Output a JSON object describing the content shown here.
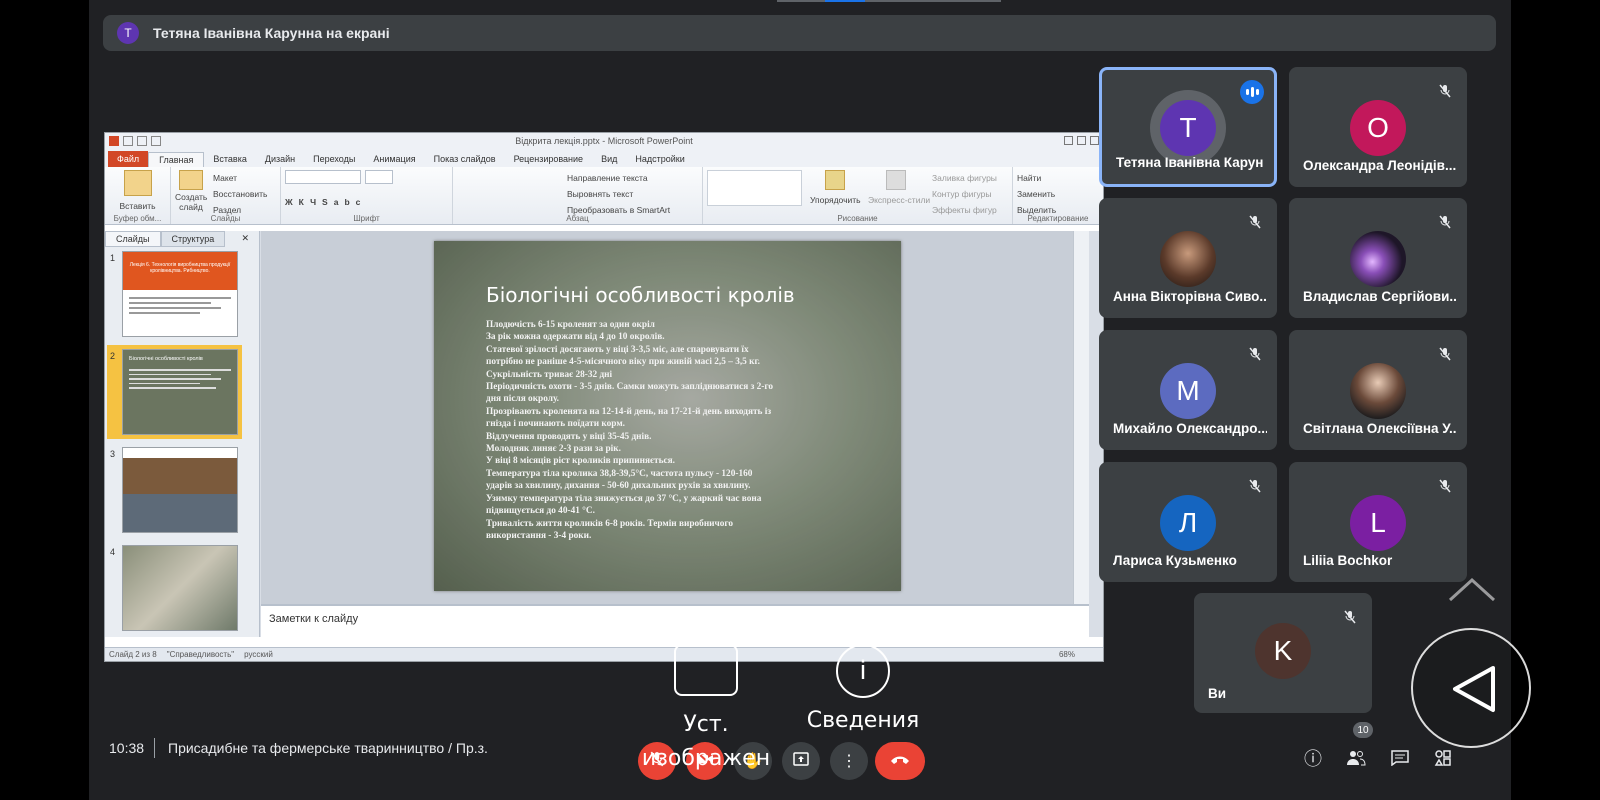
{
  "presenter_banner": {
    "initial": "T",
    "text": "Тетяна Іванівна Карунна на екрані"
  },
  "powerpoint": {
    "window_title": "Відкрита лекція.pptx - Microsoft PowerPoint",
    "tabs": [
      "Файл",
      "Главная",
      "Вставка",
      "Дизайн",
      "Переходы",
      "Анимация",
      "Показ слайдов",
      "Рецензирование",
      "Вид",
      "Надстройки"
    ],
    "ribbon": {
      "paste": "Вставить",
      "create_slide": "Создать слайд",
      "layout": "Макет",
      "restore": "Восстановить",
      "section": "Раздел",
      "text_direction": "Направление текста",
      "align_text": "Выровнять текст",
      "smartart": "Преобразовать в SmartArt",
      "arrange": "Упорядочить",
      "express_styles": "Экспресс-стили",
      "shape_fill": "Заливка фигуры",
      "shape_outline": "Контур фигуры",
      "shape_effects": "Эффекты фигур",
      "find": "Найти",
      "replace": "Заменить",
      "select": "Выделить",
      "groups": {
        "clipboard": "Буфер обм...",
        "slides": "Слайды",
        "font": "Шрифт",
        "paragraph": "Абзац",
        "drawing": "Рисование",
        "editing": "Редактирование"
      }
    },
    "panel_tabs": [
      "Слайды",
      "Структура"
    ],
    "thumb1_title": "Лекція 6. Технологія виробництва продукції кролівництва. Рибництво.",
    "thumb2_title": "Біологічні особливості кролів",
    "slide": {
      "title": "Біологічні особливості кролів",
      "lines": [
        "Плодючість 6-15 кроленят за один окріл",
        " За рік можна одержати від 4 до 10 окролів.",
        " Статевої зрілості досягають у віці 3-3,5 міс, але спаровувати їх",
        "потрібно не раніше 4-5-місячного віку при живій масі 2,5 – 3,5 кг.",
        " Сукрільність триває 28-32 дні",
        " Періодичність охоти - 3-5 днів. Самки можуть запліднюватися з 2-го",
        "дня після окролу.",
        " Прозрівають кроленята на 12-14-й день, на 17-21-й день виходять із",
        "гнізда і починають поїдати корм.",
        " Відлучення проводять у віці 35-45 днів.",
        " Молодняк линяє 2-3 рази за рік.",
        " У віці 8 місяців ріст кроликів припиняється.",
        " Температура тіла кролика 38,8-39,5°С, частота пульсу - 120-160",
        "ударів за хвилину, дихання - 50-60 дихальних рухів за хвилину.",
        "Узимку температура тіла знижується до 37 °С, у жаркий час вона",
        "підвищується до 40-41 °С.",
        " Тривалість життя кроликів 6-8 років. Термін виробничого",
        "використання - 3-4 роки."
      ]
    },
    "notes_placeholder": "Заметки к слайду",
    "status": {
      "slide": "Слайд 2 из 8",
      "theme": "\"Справедливость\"",
      "language": "русский",
      "zoom": "68%"
    }
  },
  "participants": [
    {
      "name": "Тетяна Іванівна Карун...",
      "initial": "T",
      "color": "#5e35b1",
      "active": true
    },
    {
      "name": "Олександра Леонідів...",
      "initial": "O",
      "color": "#c2185b"
    },
    {
      "name": "Анна Вікторівна Сиво...",
      "photo": true
    },
    {
      "name": "Владислав Сергійови...",
      "photo": true
    },
    {
      "name": "Михайло Олександро...",
      "initial": "M",
      "color": "#5c6bc0"
    },
    {
      "name": "Світлана Олексіївна У...",
      "photo": true
    },
    {
      "name": "Лариса Кузьменко",
      "initial": "Л",
      "color": "#1565c0"
    },
    {
      "name": "Liliia Bochkor",
      "initial": "L",
      "color": "#7b1fa2"
    },
    {
      "name": "Ви",
      "initial": "K",
      "color": "#4e342e"
    }
  ],
  "bottom_bar": {
    "time": "10:38",
    "meeting_title": "Присадибне та фермерське тваринництво / Пр.з.",
    "people_count": "10"
  },
  "overlay": {
    "settings_label": "Уст. изображен",
    "info_label": "Сведения"
  },
  "icons": {
    "mic_off": "mic-off-icon",
    "cam_off": "camera-off-icon",
    "hand": "raise-hand-icon",
    "present": "present-icon",
    "more": "more-vert-icon",
    "end": "call-end-icon",
    "info": "info-icon",
    "people": "people-icon",
    "chat": "chat-icon",
    "activities": "activities-icon"
  }
}
